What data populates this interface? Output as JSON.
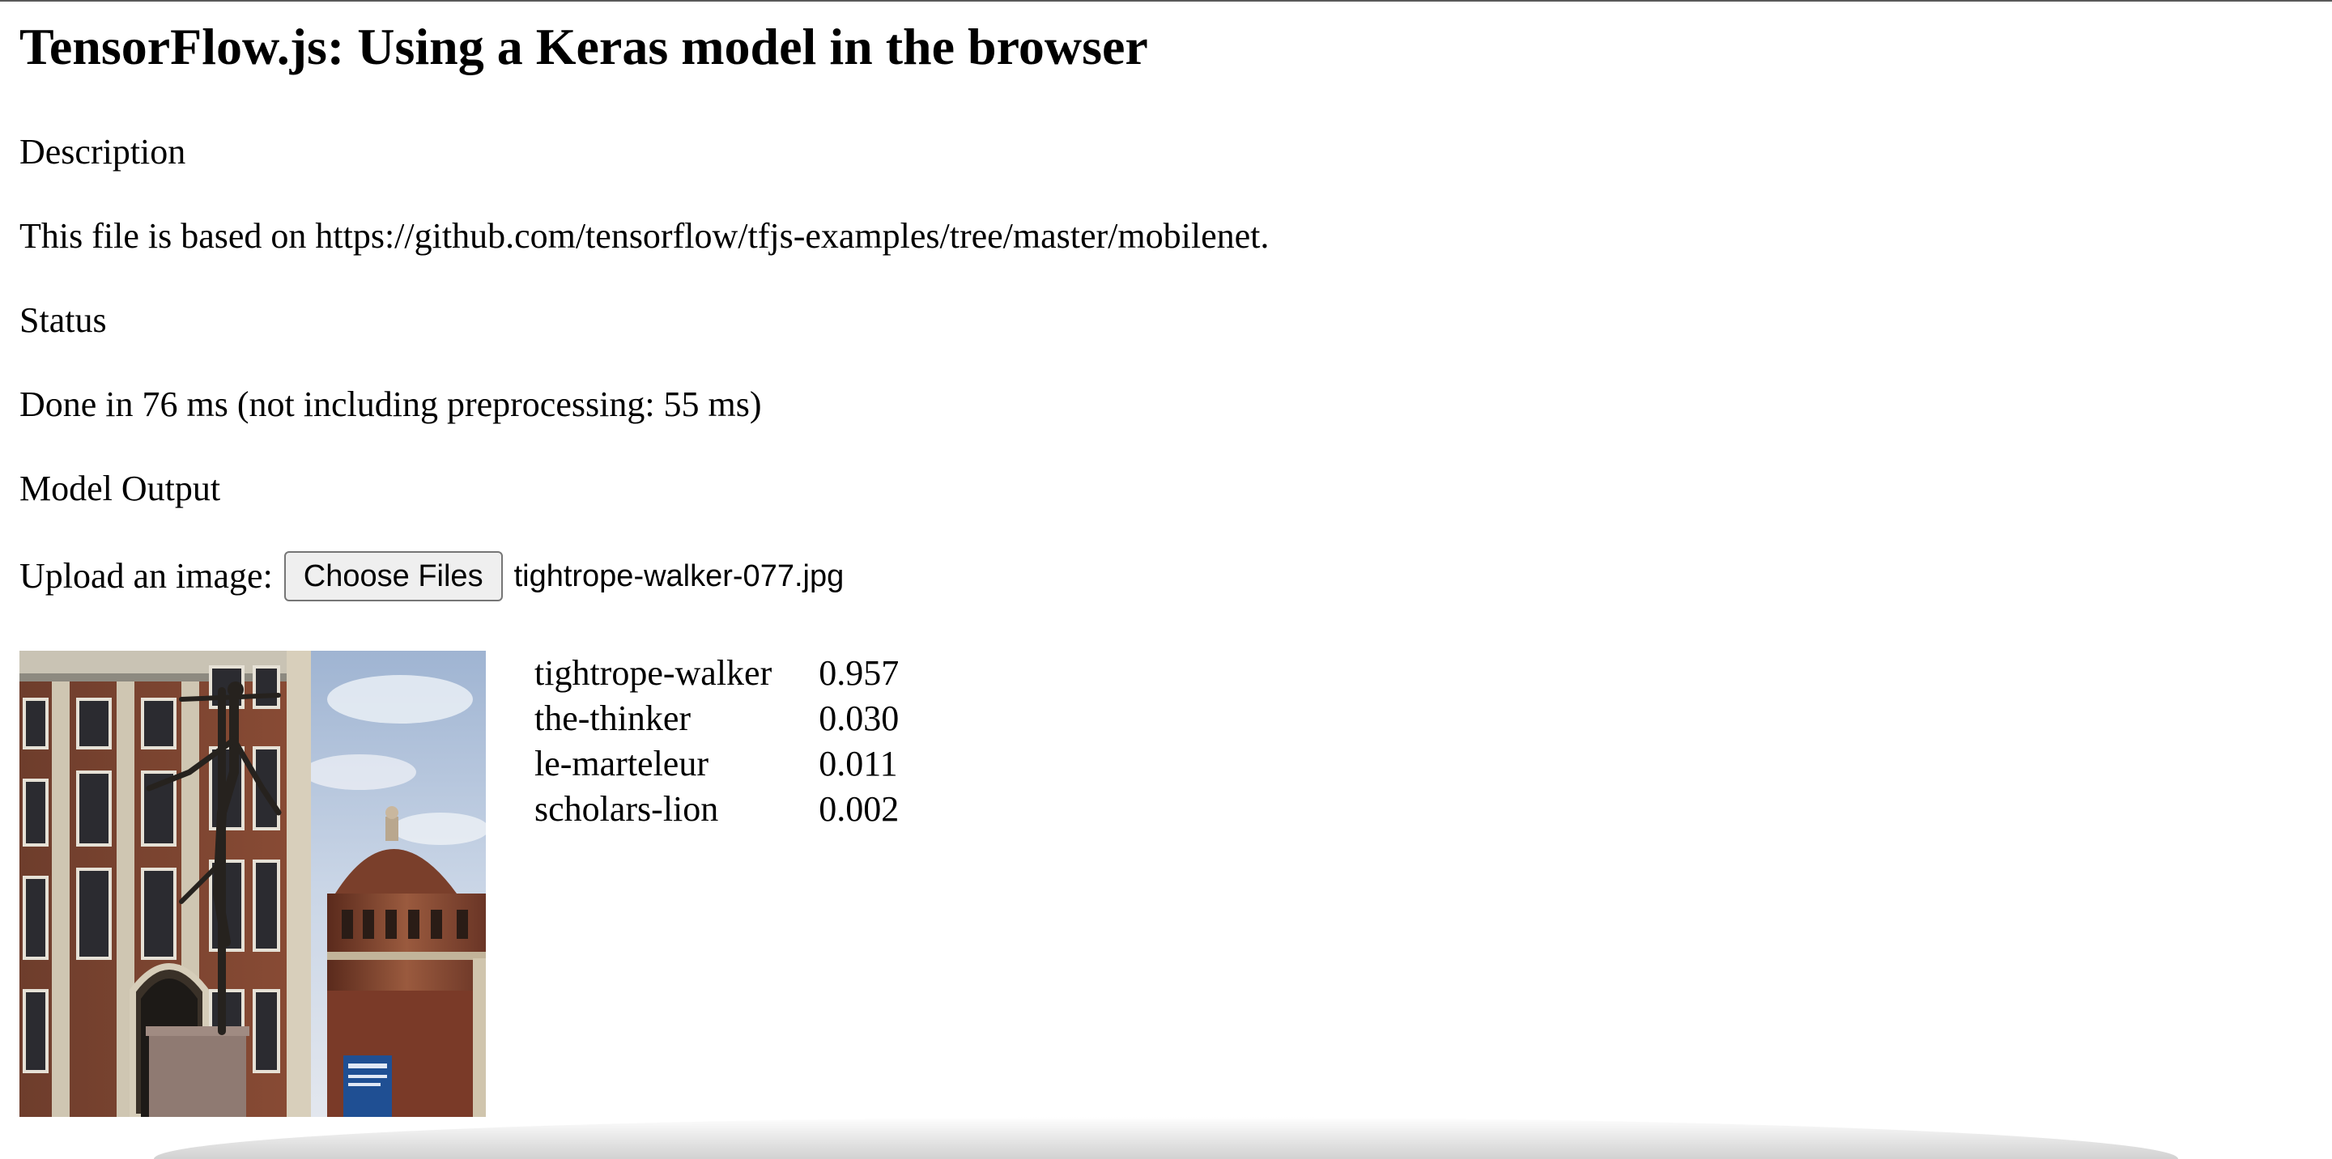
{
  "heading": "TensorFlow.js: Using a Keras model in the browser",
  "description": {
    "heading": "Description",
    "text": "This file is based on https://github.com/tensorflow/tfjs-examples/tree/master/mobilenet."
  },
  "status": {
    "heading": "Status",
    "text": "Done in 76 ms (not including preprocessing: 55 ms)"
  },
  "model_output": {
    "heading": "Model Output"
  },
  "upload": {
    "label": "Upload an image:",
    "button_label": "Choose Files",
    "file_name": "tightrope-walker-077.jpg"
  },
  "predictions": [
    {
      "label": "tightrope-walker",
      "score": "0.957"
    },
    {
      "label": "the-thinker",
      "score": "0.030"
    },
    {
      "label": "le-marteleur",
      "score": "0.011"
    },
    {
      "label": "scholars-lion",
      "score": "0.002"
    }
  ]
}
